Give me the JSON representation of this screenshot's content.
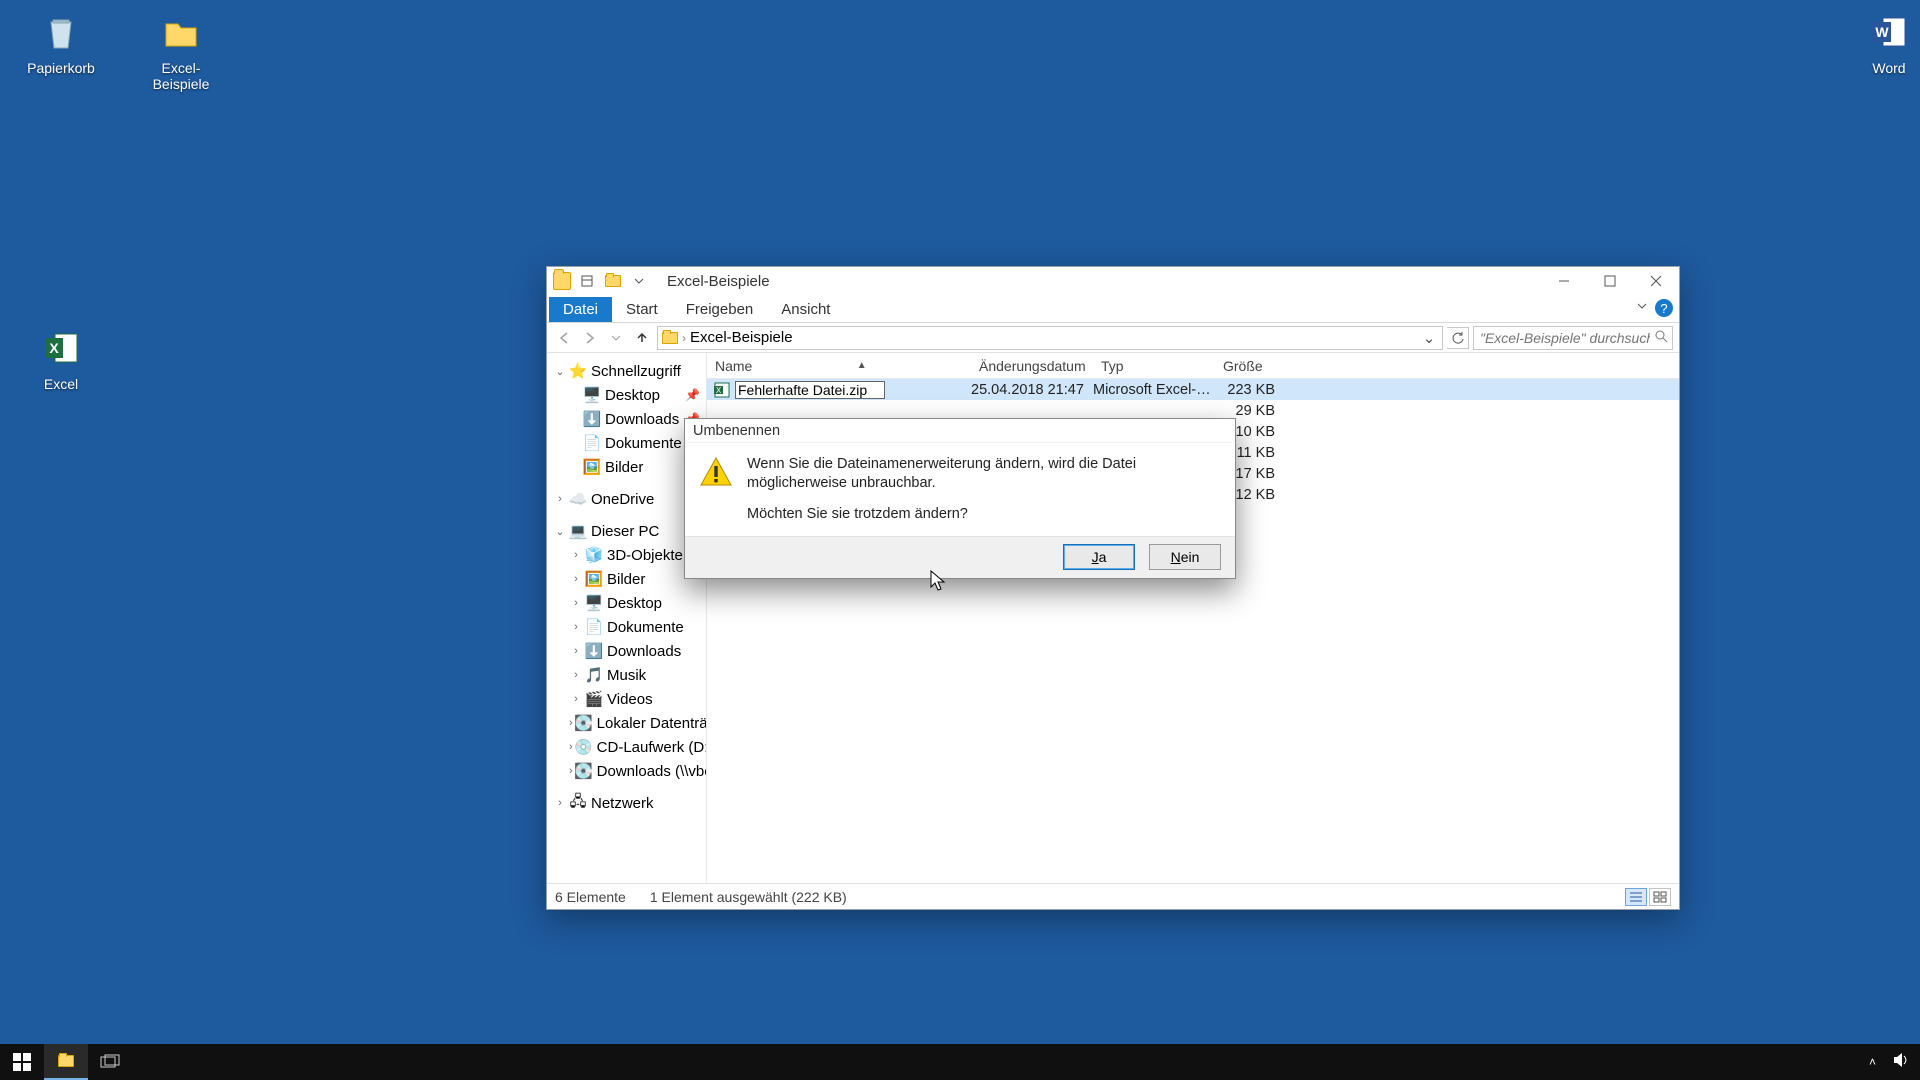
{
  "desktop": {
    "recycle_bin": "Papierkorb",
    "folder1": "Excel-Beispiele",
    "word": "Word",
    "excel": "Excel"
  },
  "explorer": {
    "title": "Excel-Beispiele",
    "tabs": {
      "file": "Datei",
      "home": "Start",
      "share": "Freigeben",
      "view": "Ansicht"
    },
    "breadcrumb": "Excel-Beispiele",
    "search_placeholder": "\"Excel-Beispiele\" durchsuchen",
    "columns": {
      "name": "Name",
      "date": "Änderungsdatum",
      "type": "Typ",
      "size": "Größe"
    },
    "rows": [
      {
        "name_edit": "Fehlerhafte Datei.zip",
        "date": "25.04.2018 21:47",
        "type": "Microsoft Excel-Ar...",
        "size": "223 KB"
      },
      {
        "size": "29 KB"
      },
      {
        "size": "10 KB"
      },
      {
        "size": "11 KB"
      },
      {
        "size": "17 KB"
      },
      {
        "size": "12 KB"
      }
    ],
    "tree": {
      "quick": "Schnellzugriff",
      "quick_items": [
        "Desktop",
        "Downloads",
        "Dokumente",
        "Bilder"
      ],
      "onedrive": "OneDrive",
      "this_pc": "Dieser PC",
      "this_pc_items": [
        "3D-Objekte",
        "Bilder",
        "Desktop",
        "Dokumente",
        "Downloads",
        "Musik",
        "Videos",
        "Lokaler Datenträger",
        "CD-Laufwerk (D:) Vi",
        "Downloads (\\\\vbox"
      ],
      "network": "Netzwerk"
    },
    "status": {
      "count": "6 Elemente",
      "selection": "1 Element ausgewählt (222 KB)"
    }
  },
  "dialog": {
    "title": "Umbenennen",
    "line1": "Wenn Sie die Dateinamenerweiterung ändern, wird die Datei möglicherweise unbrauchbar.",
    "line2": "Möchten Sie sie trotzdem ändern?",
    "yes": "Ja",
    "no": "Nein"
  }
}
